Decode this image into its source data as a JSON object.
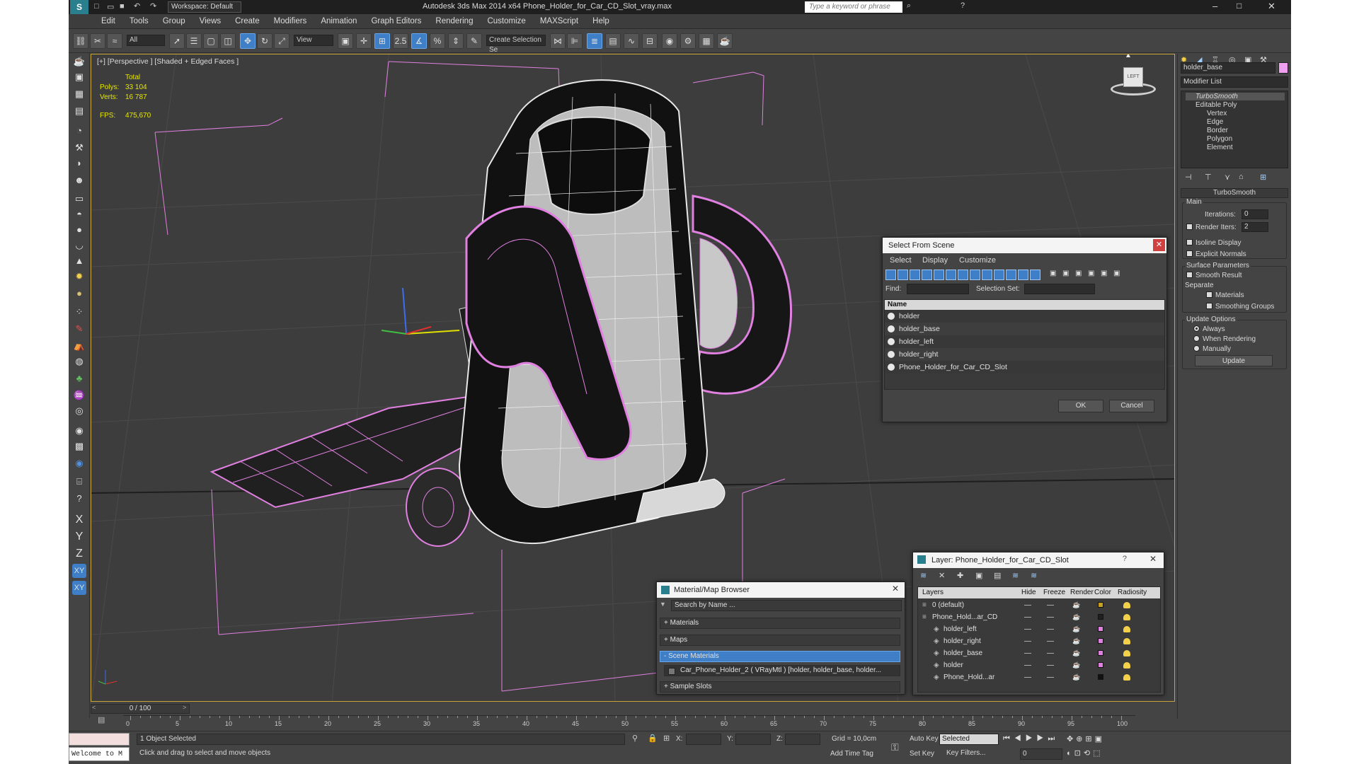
{
  "app": {
    "title": "Autodesk 3ds Max  2014 x64     Phone_Holder_for_Car_CD_Slot_vray.max",
    "workspace": "Workspace: Default",
    "search_placeholder": "Type a keyword or phrase"
  },
  "menu": [
    "Edit",
    "Tools",
    "Group",
    "Views",
    "Create",
    "Modifiers",
    "Animation",
    "Graph Editors",
    "Rendering",
    "Customize",
    "MAXScript",
    "Help"
  ],
  "toolbar": {
    "selection_filter": "All",
    "ref_coord": "View",
    "named_selection": "Create Selection Se",
    "snap_label": "2.5"
  },
  "viewport": {
    "label": "[+] [Perspective ] [Shaded + Edged Faces ]",
    "stats": {
      "total_label": "Total",
      "polys_label": "Polys:",
      "polys": "33 104",
      "verts_label": "Verts:",
      "verts": "16 787",
      "fps_label": "FPS:",
      "fps": "475,670"
    },
    "viewcube_label": "LEFT"
  },
  "select_from_scene": {
    "title": "Select From Scene",
    "menu": [
      "Select",
      "Display",
      "Customize"
    ],
    "find_label": "Find:",
    "selection_set_label": "Selection Set:",
    "column_name": "Name",
    "items": [
      "holder",
      "holder_base",
      "holder_left",
      "holder_right",
      "Phone_Holder_for_Car_CD_Slot"
    ],
    "ok": "OK",
    "cancel": "Cancel"
  },
  "layer_dialog": {
    "title": "Layer: Phone_Holder_for_Car_CD_Slot",
    "columns": [
      "Layers",
      "Hide",
      "Freeze",
      "Render",
      "Color",
      "Radiosity"
    ],
    "rows": [
      {
        "name": "0 (default)",
        "color": "#c8a020"
      },
      {
        "name": "Phone_Hold...ar_CD",
        "color": "#202020"
      },
      {
        "name": "holder_left",
        "color": "#e080e0"
      },
      {
        "name": "holder_right",
        "color": "#e080e0"
      },
      {
        "name": "holder_base",
        "color": "#e080e0"
      },
      {
        "name": "holder",
        "color": "#e080e0"
      },
      {
        "name": "Phone_Hold...ar",
        "color": "#111111"
      }
    ]
  },
  "material_browser": {
    "title": "Material/Map Browser",
    "search_placeholder": "Search by Name ...",
    "sections": [
      "+ Materials",
      "+ Maps",
      "- Scene Materials"
    ],
    "scene_material": "Car_Phone_Holder_2  ( VRayMtl ) [holder, holder_base, holder...",
    "sample_slots": "+ Sample Slots"
  },
  "command_panel": {
    "object_name": "holder_base",
    "modifier_list": "Modifier List",
    "stack": [
      "TurboSmooth",
      "Editable Poly",
      "Vertex",
      "Edge",
      "Border",
      "Polygon",
      "Element"
    ],
    "rollout_title": "TurboSmooth",
    "main_label": "Main",
    "iterations_label": "Iterations:",
    "iterations": "0",
    "render_iters_label": "Render Iters:",
    "render_iters": "2",
    "isoline": "Isoline Display",
    "explicit_normals": "Explicit Normals",
    "surface_params": "Surface Parameters",
    "smooth_result": "Smooth Result",
    "separate": "Separate",
    "materials": "Materials",
    "smoothing_groups": "Smoothing Groups",
    "update_options": "Update Options",
    "always": "Always",
    "when_rendering": "When Rendering",
    "manually": "Manually",
    "update_button": "Update",
    "object_color": "#f0a0f0"
  },
  "timeline": {
    "frame": "0 / 100",
    "ticks": [
      "0",
      "5",
      "10",
      "15",
      "20",
      "25",
      "30",
      "35",
      "40",
      "45",
      "50",
      "55",
      "60",
      "65",
      "70",
      "75",
      "80",
      "85",
      "90",
      "95",
      "100"
    ]
  },
  "axis_buttons": [
    "X",
    "Y",
    "Z",
    "XY",
    "XY"
  ],
  "status": {
    "maxscript": "Welcome to M",
    "selected": "1 Object Selected",
    "prompt": "Click and drag to select and move objects",
    "x_label": "X:",
    "y_label": "Y:",
    "z_label": "Z:",
    "grid": "Grid = 10,0cm",
    "add_time_tag": "Add Time Tag",
    "auto_key": "Auto Key",
    "set_key": "Set Key",
    "selected_dd": "Selected",
    "key_filters": "Key Filters...",
    "frame_field": "0"
  },
  "colors": {
    "accent": "#3f7fc8",
    "viewport_border": "#c8a33a",
    "wire_pink": "#e080e0",
    "stats_yellow": "#e6e600"
  }
}
